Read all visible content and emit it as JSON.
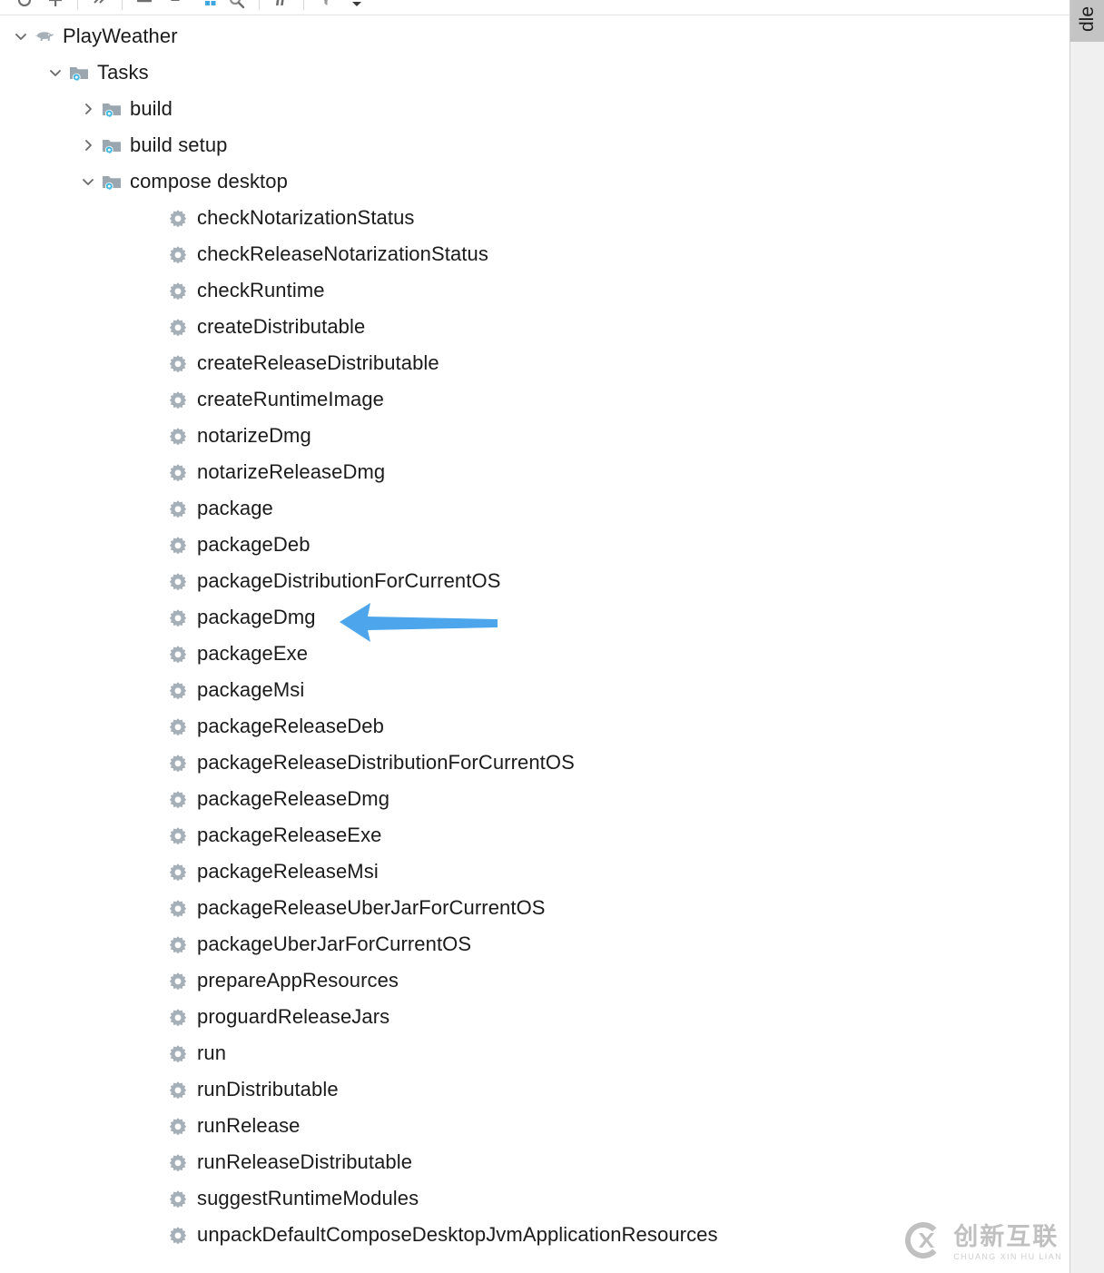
{
  "toolbar": {
    "buttons": [
      {
        "name": "expand-all-icon",
        "title": "Expand All"
      },
      {
        "name": "collapse-all-icon",
        "title": "Collapse All"
      },
      {
        "name": "link-icon",
        "title": "Link"
      },
      {
        "name": "minus-icon",
        "title": "Remove"
      },
      {
        "name": "upload-icon",
        "title": "Execute"
      },
      {
        "name": "toggle-offline-icon",
        "title": "Toggle Offline Mode"
      },
      {
        "name": "search-icon",
        "title": "Search"
      },
      {
        "name": "task-execution-icon",
        "title": "Task Execution"
      },
      {
        "name": "filter-icon",
        "title": "Show Options Menu"
      }
    ]
  },
  "stripe": {
    "tab_label": "dle"
  },
  "tree": {
    "root": {
      "label": "PlayWeather",
      "icon": "gradle-elephant-icon",
      "expanded": true,
      "twisty": "chevron-down-icon"
    },
    "tasks_node": {
      "label": "Tasks",
      "icon": "folder-gear-icon",
      "expanded": true,
      "twisty": "chevron-down-icon"
    },
    "groups": [
      {
        "label": "build",
        "icon": "folder-gear-icon",
        "expanded": false,
        "twisty": "chevron-right-icon"
      },
      {
        "label": "build setup",
        "icon": "folder-gear-icon",
        "expanded": false,
        "twisty": "chevron-right-icon"
      },
      {
        "label": "compose desktop",
        "icon": "folder-gear-icon",
        "expanded": true,
        "twisty": "chevron-down-icon"
      }
    ],
    "tasks": [
      "checkNotarizationStatus",
      "checkReleaseNotarizationStatus",
      "checkRuntime",
      "createDistributable",
      "createReleaseDistributable",
      "createRuntimeImage",
      "notarizeDmg",
      "notarizeReleaseDmg",
      "package",
      "packageDeb",
      "packageDistributionForCurrentOS",
      "packageDmg",
      "packageExe",
      "packageMsi",
      "packageReleaseDeb",
      "packageReleaseDistributionForCurrentOS",
      "packageReleaseDmg",
      "packageReleaseExe",
      "packageReleaseMsi",
      "packageReleaseUberJarForCurrentOS",
      "packageUberJarForCurrentOS",
      "prepareAppResources",
      "proguardReleaseJars",
      "run",
      "runDistributable",
      "runRelease",
      "runReleaseDistributable",
      "suggestRuntimeModules",
      "unpackDefaultComposeDesktopJvmApplicationResources"
    ],
    "task_icon": "gear-icon"
  },
  "annotation": {
    "arrow": {
      "name": "pointer-arrow",
      "points_to": "packageDmg",
      "color": "#4da6ec",
      "direction": "left"
    }
  },
  "watermark": {
    "cn": "创新互联",
    "en": "CHUANG XIN HU LIAN",
    "logo": "cx-circle-logo"
  },
  "colors": {
    "accent_blue": "#4da6ec",
    "folder_gray": "#9aa7b0",
    "gear_blue": "#40b6e0",
    "task_gear": "#a6b0b8",
    "text": "#1b1b1b",
    "stripe_bg": "#f0f0f0",
    "stripe_tab_bg": "#c4c4c4"
  }
}
